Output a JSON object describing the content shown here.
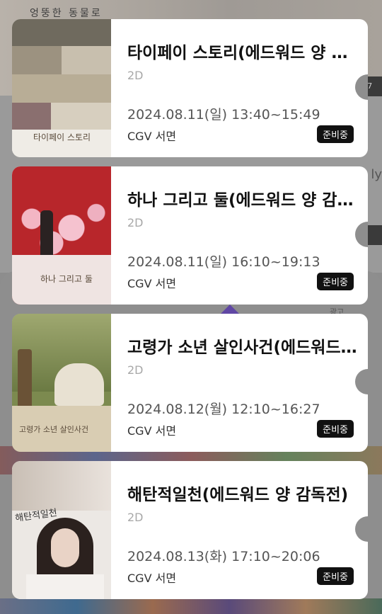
{
  "background": {
    "top_title": "엉뚱한 동물로",
    "pill_text": "/ 7",
    "edge_text": "ly",
    "ad_label": "광고"
  },
  "tickets": [
    {
      "title": "타이페이 스토리(에드워드 양 감독전)",
      "format": "2D",
      "datetime": "2024.08.11(일) 13:40~15:49",
      "venue": "CGV 서면",
      "status": "준비중",
      "poster_text": "타이페이 스토리"
    },
    {
      "title": "하나 그리고 둘(에드워드 양 감독전)",
      "format": "2D",
      "datetime": "2024.08.11(일) 16:10~19:13",
      "venue": "CGV 서면",
      "status": "준비중",
      "poster_text": "하나 그리고 둘"
    },
    {
      "title": "고령가 소년 살인사건(에드워드 양 감독전)",
      "format": "2D",
      "datetime": "2024.08.12(월) 12:10~16:27",
      "venue": "CGV 서면",
      "status": "준비중",
      "poster_text": "고령가 소년 살인사건"
    },
    {
      "title": "해탄적일천(에드워드 양 감독전)",
      "format": "2D",
      "datetime": "2024.08.13(화) 17:10~20:06",
      "venue": "CGV 서면",
      "status": "준비중",
      "poster_text": "해탄적일천"
    }
  ]
}
